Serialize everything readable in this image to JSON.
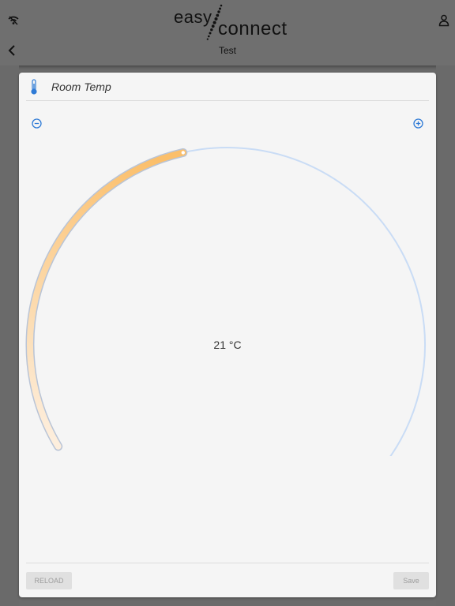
{
  "app_bar": {
    "logo_top": "easy",
    "logo_bottom": "connect",
    "page_title": "Test",
    "icons": {
      "left": "wifi-off-icon",
      "right": "user-icon",
      "back": "chevron-left-icon"
    }
  },
  "card": {
    "icon": "thermometer-icon",
    "title": "Room Temp",
    "decrease_icon": "minus-circle-icon",
    "increase_icon": "plus-circle-icon",
    "gauge": {
      "display": "21 °C",
      "level_fraction": 0.36,
      "colors": {
        "track": "#c9dcf5",
        "fill_start": "#fdeedd",
        "fill_end": "#fbbf6b",
        "accent": "#2f7bd6"
      }
    },
    "buttons": {
      "reload": "RELOAD",
      "save": "Save"
    }
  }
}
